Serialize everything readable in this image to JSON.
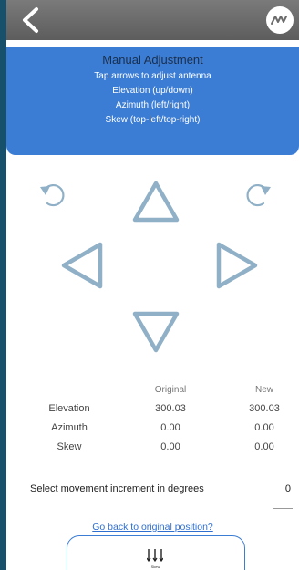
{
  "header": {
    "back_icon": "chevron-left-icon",
    "logo_icon": "brand-logo-icon"
  },
  "info": {
    "title": "Manual Adjustment",
    "line1": "Tap arrows to adjust antenna",
    "line2": "Elevation (up/down)",
    "line3": "Azimuth (left/right)",
    "line4": "Skew (top-left/top-right)"
  },
  "controls": {
    "rotate_left_icon": "rotate-counterclockwise-icon",
    "rotate_right_icon": "rotate-clockwise-icon",
    "up_icon": "triangle-up-icon",
    "down_icon": "triangle-down-icon",
    "left_icon": "triangle-left-icon",
    "right_icon": "triangle-right-icon",
    "color": "#8fb0c6"
  },
  "table": {
    "headers": [
      "Original",
      "New"
    ],
    "rows": [
      {
        "label": "Elevation",
        "original": "300.03",
        "new": "300.03"
      },
      {
        "label": "Azimuth",
        "original": "0.00",
        "new": "0.00"
      },
      {
        "label": "Skew",
        "original": "0.00",
        "new": "0.00"
      }
    ]
  },
  "increment": {
    "label": "Select movement increment in degrees",
    "value": "0"
  },
  "reset_link": "Go back to original position?",
  "skew_button": {
    "label": "Skew",
    "icon": "skew-arrows-icon"
  },
  "colors": {
    "accent": "#3b7dd4",
    "frame": "#17506a",
    "topbar": "#6b6b6b",
    "link": "#2f6fd0"
  }
}
